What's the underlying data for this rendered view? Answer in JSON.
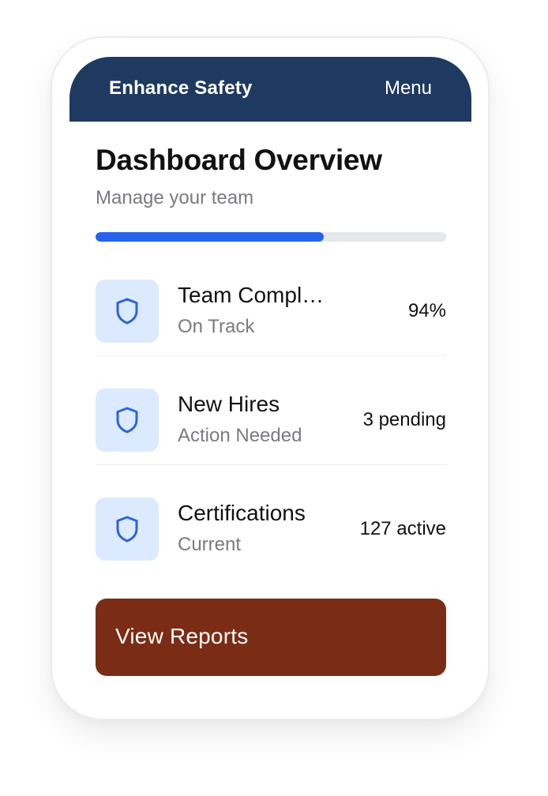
{
  "header": {
    "title": "Enhance Safety",
    "menu_label": "Menu"
  },
  "dashboard": {
    "title": "Dashboard Overview",
    "subtitle": "Manage your team",
    "progress": 0.65
  },
  "items": [
    {
      "title": "Team Compliance",
      "status": "On Track",
      "value": "94%",
      "icon": "shield-icon"
    },
    {
      "title": "New Hires",
      "status": "Action Needed",
      "value": "3 pending",
      "icon": "shield-icon"
    },
    {
      "title": "Certifications",
      "status": "Current",
      "value": "127 active",
      "icon": "shield-icon"
    }
  ],
  "cta": {
    "label": "View Reports"
  },
  "colors": {
    "header_bg": "#1f3a60",
    "progress_fill": "#2563eb",
    "icon_bg": "#dbeafe",
    "icon_stroke": "#2f63d6",
    "cta_bg": "#7b2c14"
  }
}
